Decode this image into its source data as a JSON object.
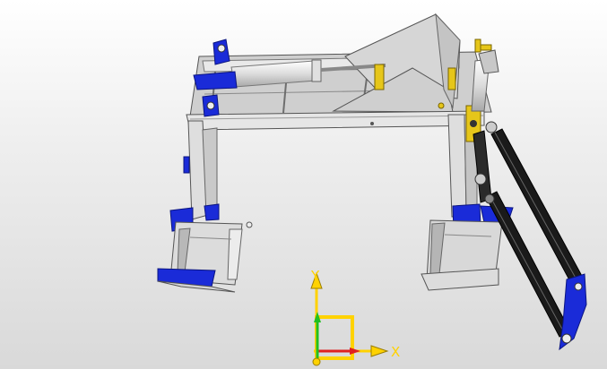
{
  "viewport": {
    "background_top": "#ffffff",
    "background_bottom": "#d9d9d9"
  },
  "model": {
    "frame_color": "#d7d7d7",
    "frame_edge_color": "#6e6e6e",
    "bracket_color": "#1a2bd8",
    "accent_color": "#e6c61a",
    "cylinder_color": "#1a1a1a"
  },
  "triad": {
    "x_label": "X",
    "y_label": "Y",
    "x_color": "#ffd200",
    "y_color": "#ffd200",
    "x_arrow_color": "#e02020",
    "y_arrow_color": "#20c020"
  }
}
